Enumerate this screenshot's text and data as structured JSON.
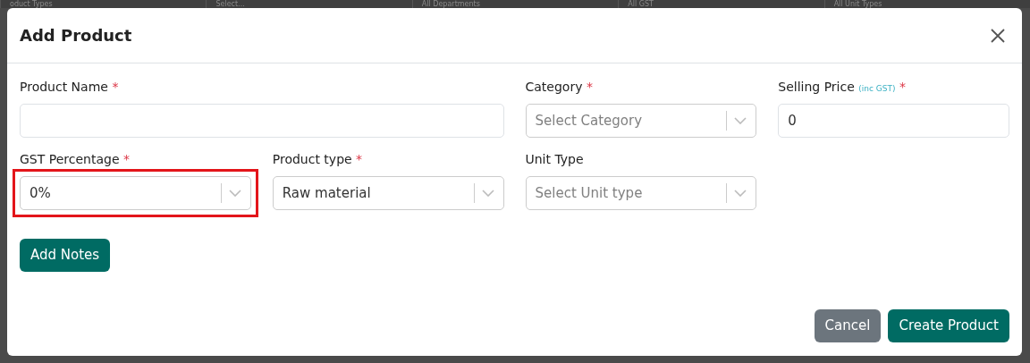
{
  "backdrop": {
    "filters": [
      "oduct Types",
      "Select...",
      "All Departments",
      "All GST",
      "All Unit Types"
    ]
  },
  "modal": {
    "title": "Add Product",
    "fields": [
      {
        "kind": "input",
        "label": "Product Name",
        "required_mark": "*",
        "highlighted": false
      },
      {
        "kind": "select",
        "label": "Category",
        "required_mark": "*",
        "placeholder": "Select Category",
        "highlighted": false
      },
      {
        "kind": "input",
        "label": "Selling Price",
        "hint": "(inc GST)",
        "required_mark": "*",
        "value": "0",
        "highlighted": false
      },
      {
        "kind": "select",
        "label": "GST Percentage",
        "required_mark": "*",
        "value": "0%",
        "highlighted": true
      },
      {
        "kind": "select",
        "label": "Product type",
        "required_mark": "*",
        "value": "Raw material",
        "highlighted": false
      },
      {
        "kind": "select",
        "label": "Unit Type",
        "placeholder": "Select Unit type",
        "highlighted": false
      }
    ],
    "notes_button": "Add Notes",
    "footer": [
      {
        "label": "Cancel",
        "kind": "secondary"
      },
      {
        "label": "Create Product",
        "kind": "primary"
      }
    ]
  }
}
